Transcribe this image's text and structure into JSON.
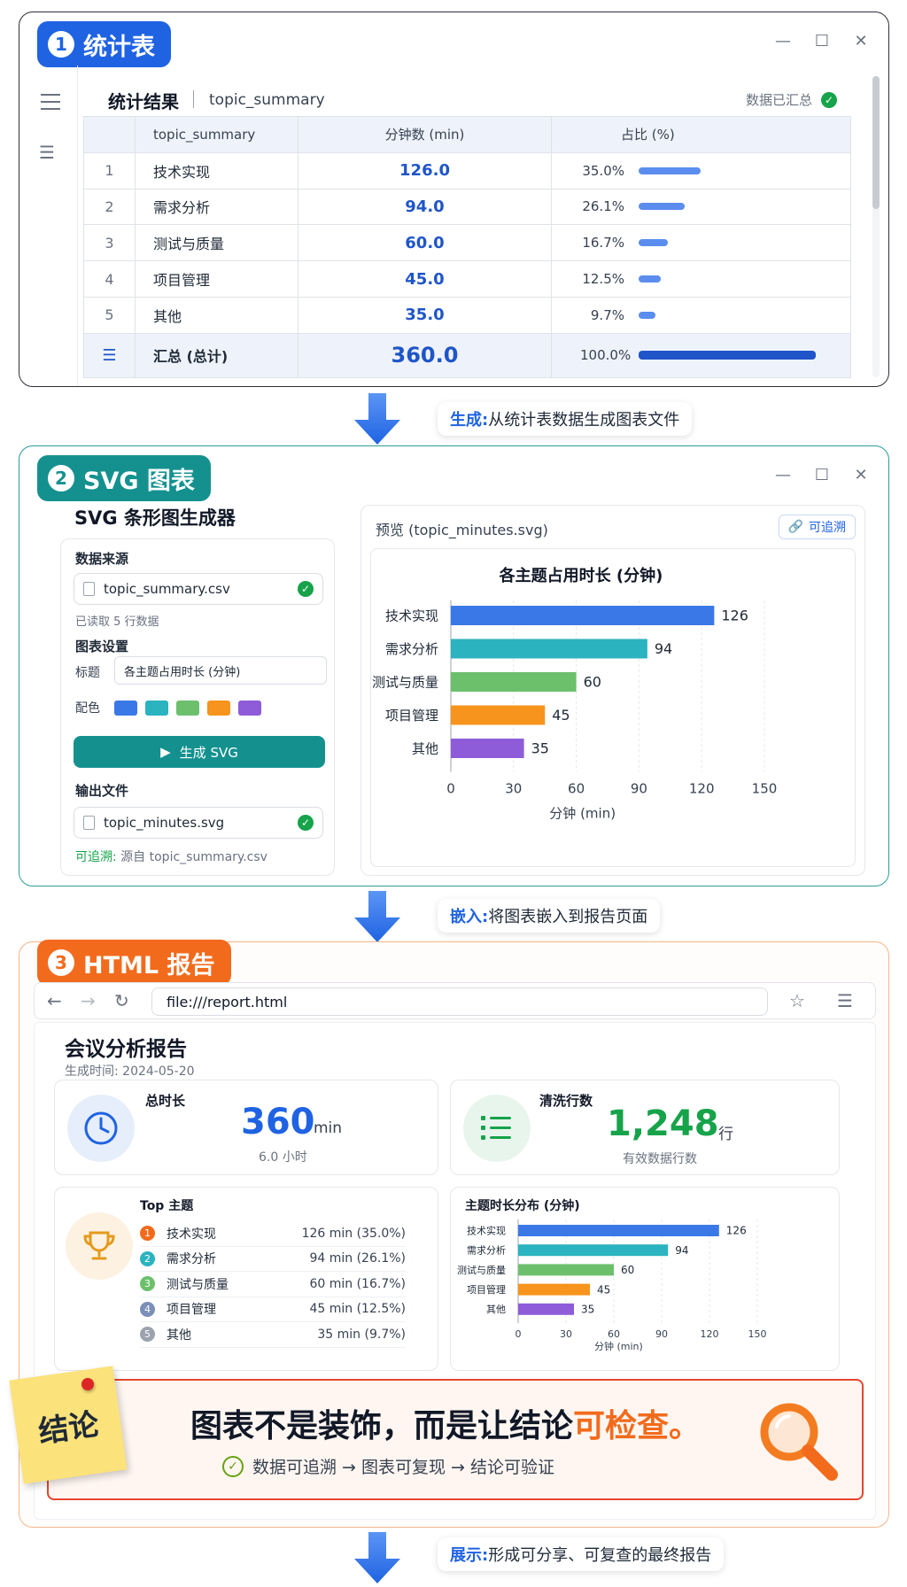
{
  "win1": {
    "badge_num": "1",
    "badge_label": "统计表",
    "title": "统计结果",
    "subtitle": "topic_summary",
    "status": "数据已汇总",
    "headers": [
      "topic_summary",
      "分钟数 (min)",
      "占比 (%)"
    ],
    "rows": [
      {
        "idx": "1",
        "name": "技术实现",
        "minutes": "126.0",
        "pct": "35.0%",
        "pct_value": 35.0
      },
      {
        "idx": "2",
        "name": "需求分析",
        "minutes": "94.0",
        "pct": "26.1%",
        "pct_value": 26.1
      },
      {
        "idx": "3",
        "name": "测试与质量",
        "minutes": "60.0",
        "pct": "16.7%",
        "pct_value": 16.7
      },
      {
        "idx": "4",
        "name": "项目管理",
        "minutes": "45.0",
        "pct": "12.5%",
        "pct_value": 12.5
      },
      {
        "idx": "5",
        "name": "其他",
        "minutes": "35.0",
        "pct": "9.7%",
        "pct_value": 9.7
      }
    ],
    "total": {
      "name": "汇总 (总计)",
      "minutes": "360.0",
      "pct": "100.0%",
      "pct_value": 100.0
    }
  },
  "annot1": {
    "key": "生成:",
    "text": "从统计表数据生成图表文件"
  },
  "win2": {
    "badge_num": "2",
    "badge_label": "SVG 图表",
    "panel_title": "SVG 条形图生成器",
    "source_label": "数据来源",
    "source_file": "topic_summary.csv",
    "rows_read": "已读取 5 行数据",
    "settings_label": "图表设置",
    "title_label": "标题",
    "title_value": "各主题占用时长 (分钟)",
    "color_label": "配色",
    "palette": [
      "#3b78e7",
      "#2bb3bf",
      "#6cc06c",
      "#f7941d",
      "#8e5cd9"
    ],
    "generate_button": "生成 SVG",
    "output_label": "输出文件",
    "output_file": "topic_minutes.svg",
    "trace_key": "可追溯:",
    "trace_text": "源自 topic_summary.csv",
    "preview_title": "预览 (topic_minutes.svg)",
    "preview_trace": "可追溯"
  },
  "annot2": {
    "key": "嵌入:",
    "text": "将图表嵌入到报告页面"
  },
  "win3": {
    "badge_num": "3",
    "badge_label": "HTML 报告",
    "url": "file:///report.html",
    "report_title": "会议分析报告",
    "generated_at": "生成时间: 2024-05-20",
    "total_label": "总时长",
    "total_value": "360",
    "total_unit": "min",
    "total_sub": "6.0 小时",
    "clean_label": "清洗行数",
    "clean_value": "1,248",
    "clean_unit": "行",
    "clean_sub": "有效数据行数",
    "top_label": "Top 主题",
    "top_items": [
      {
        "n": "1",
        "name": "技术实现",
        "value": "126 min (35.0%)",
        "color": "#f26b1d"
      },
      {
        "n": "2",
        "name": "需求分析",
        "value": "94 min (26.1%)",
        "color": "#2bb3bf"
      },
      {
        "n": "3",
        "name": "测试与质量",
        "value": "60 min (16.7%)",
        "color": "#6cc06c"
      },
      {
        "n": "4",
        "name": "项目管理",
        "value": "45 min (12.5%)",
        "color": "#7b8fb8"
      },
      {
        "n": "5",
        "name": "其他",
        "value": "35 min (9.7%)",
        "color": "#9ca3af"
      }
    ],
    "dist_label": "主题时长分布 (分钟)",
    "note": "结论",
    "conclusion_main_a": "图表不是装饰，而是让结论",
    "conclusion_main_b": "可检查。",
    "conclusion_sub": "数据可追溯 → 图表可复现 → 结论可验证"
  },
  "annot3": {
    "key": "展示:",
    "text": "形成可分享、可复查的最终报告"
  },
  "chart_data": [
    {
      "type": "bar",
      "orientation": "horizontal",
      "title": "各主题占用时长 (分钟)",
      "categories": [
        "技术实现",
        "需求分析",
        "测试与质量",
        "项目管理",
        "其他"
      ],
      "values": [
        126,
        94,
        60,
        45,
        35
      ],
      "colors": [
        "#3b78e7",
        "#2bb3bf",
        "#6cc06c",
        "#f7941d",
        "#8e5cd9"
      ],
      "xlabel": "分钟 (min)",
      "xticks": [
        0,
        30,
        60,
        90,
        120,
        150
      ],
      "xlim": [
        0,
        150
      ],
      "grid": true
    },
    {
      "type": "bar",
      "orientation": "horizontal",
      "title": "主题时长分布 (分钟)",
      "categories": [
        "技术实现",
        "需求分析",
        "测试与质量",
        "项目管理",
        "其他"
      ],
      "values": [
        126,
        94,
        60,
        45,
        35
      ],
      "colors": [
        "#3b78e7",
        "#2bb3bf",
        "#6cc06c",
        "#f7941d",
        "#8e5cd9"
      ],
      "xlabel": "分钟 (min)",
      "xticks": [
        0,
        30,
        60,
        90,
        120,
        150
      ],
      "xlim": [
        0,
        150
      ],
      "grid": true
    }
  ]
}
